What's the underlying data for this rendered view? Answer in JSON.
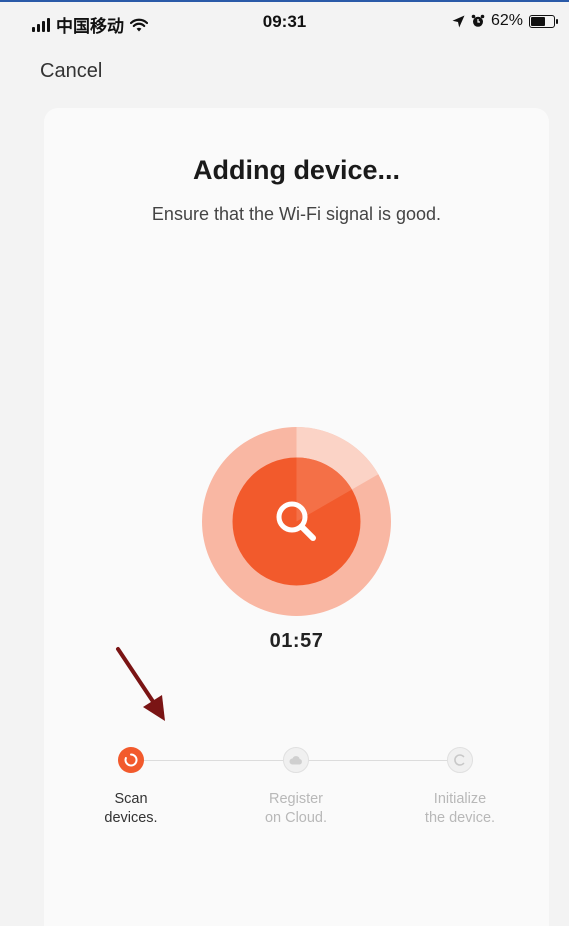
{
  "status_bar": {
    "carrier": "中国移动",
    "time": "09:31",
    "battery_percent": "62%",
    "battery_level": 0.62
  },
  "nav": {
    "cancel_label": "Cancel"
  },
  "main": {
    "title": "Adding device...",
    "subtitle": "Ensure that the Wi-Fi signal is good.",
    "timer": "01:57",
    "accent_color": "#f25a2c"
  },
  "steps": [
    {
      "line1": "Scan",
      "line2": "devices.",
      "state": "active",
      "icon": "spinner-icon"
    },
    {
      "line1": "Register",
      "line2": "on Cloud.",
      "state": "pending",
      "icon": "cloud-icon"
    },
    {
      "line1": "Initialize",
      "line2": "the device.",
      "state": "pending",
      "icon": "initialize-icon"
    }
  ]
}
